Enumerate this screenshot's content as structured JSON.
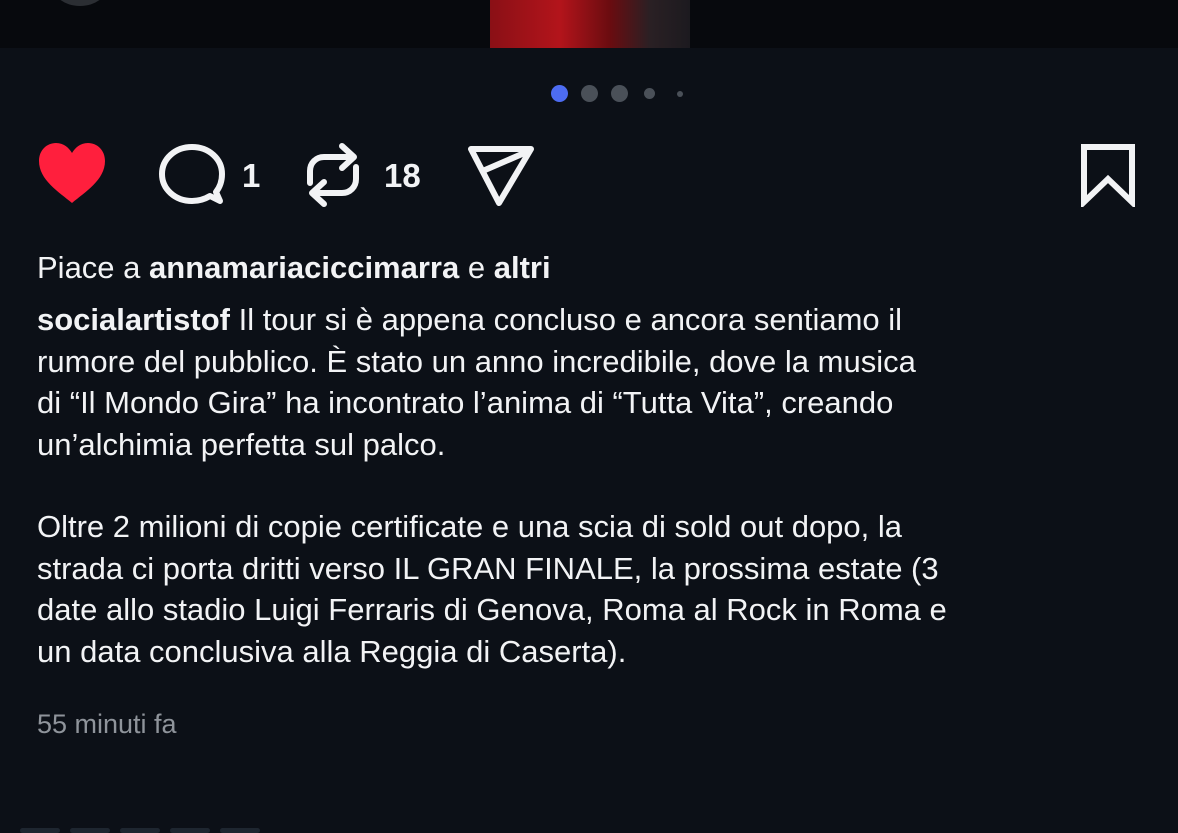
{
  "carousel": {
    "total_dots": 5,
    "active_index": 0
  },
  "actions": {
    "like_icon": "heart-filled-icon",
    "like_color": "#ff1f3d",
    "comment_icon": "comment-bubble-icon",
    "comment_count": "1",
    "repost_icon": "repost-icon",
    "repost_count": "18",
    "share_icon": "send-icon",
    "save_icon": "bookmark-icon"
  },
  "likes": {
    "prefix": "Piace a",
    "user": "annamariaciccimarra",
    "connector": "e",
    "others": "altri"
  },
  "caption": {
    "author": "socialartistof",
    "paragraph1_lines": [
      "Il tour si è appena concluso e ancora sentiamo il",
      "rumore del pubblico. È stato un anno incredibile, dove la musica",
      "di “Il Mondo Gira” ha incontrato l’anima di “Tutta Vita”, creando",
      "un’alchimia perfetta sul palco."
    ],
    "paragraph2_lines": [
      "Oltre 2 milioni di copie certificate e una scia di sold out dopo, la",
      "strada ci porta dritti verso IL GRAN FINALE, la prossima estate (3",
      "date allo stadio Luigi Ferraris di Genova, Roma al Rock in Roma e",
      "un data conclusiva alla Reggia di Caserta)."
    ]
  },
  "timestamp": "55 minuti fa",
  "colors": {
    "background": "#0c1017",
    "accent_dot": "#4d6cf2",
    "text": "#f2f3f5",
    "muted": "#8f949b"
  }
}
